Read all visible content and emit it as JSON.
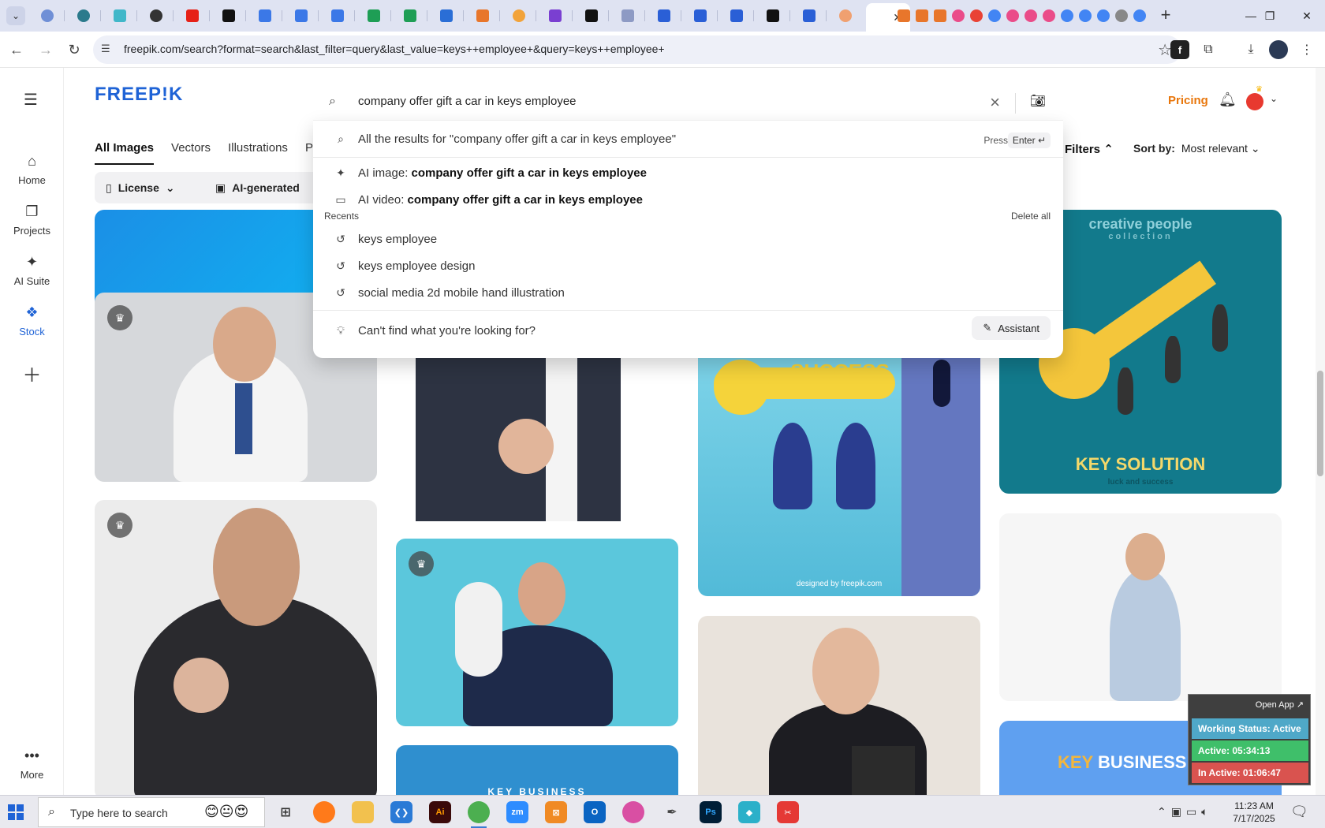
{
  "browser": {
    "active_tab_close": "✕",
    "new_tab": "+",
    "window_controls": [
      "—",
      "❐",
      "✕"
    ],
    "url": "freepik.com/search?format=search&last_filter=query&last_value=keys++employee+&query=keys++employee+"
  },
  "freepik": {
    "logo": "FREEP!K",
    "leftnav": [
      {
        "label": "Home",
        "icon": "home-icon"
      },
      {
        "label": "Projects",
        "icon": "projects-icon"
      },
      {
        "label": "AI Suite",
        "icon": "sparkle-icon"
      },
      {
        "label": "Stock",
        "icon": "stock-icon"
      },
      {
        "label": "",
        "icon": "plus-icon"
      },
      {
        "label": "More",
        "icon": "more-icon"
      }
    ],
    "header": {
      "pricing": "Pricing"
    },
    "tabs": [
      "All Images",
      "Vectors",
      "Illustrations",
      "Ph"
    ],
    "filters": {
      "license": "License",
      "ai_generated": "AI-generated",
      "filters_link": "Filters",
      "sort_label": "Sort by:",
      "sort_value": "Most relevant"
    },
    "search": {
      "query": "company offer gift a car in keys  employee",
      "all_results": "All the results for \"company offer gift a car in keys employee\"",
      "press": "Press",
      "enter": "Enter ↵",
      "ai_image_prefix": "AI image:",
      "ai_image_query": "company offer gift a car in keys employee",
      "ai_video_prefix": "AI video:",
      "ai_video_query": "company offer gift a car in keys employee",
      "recents_label": "Recents",
      "delete_all": "Delete all",
      "recents": [
        "keys employee",
        "keys employee design",
        "social media 2d mobile hand illustration"
      ],
      "cant_find": "Can't find what you're looking for?",
      "assistant": "Assistant"
    },
    "cards": {
      "credit": "designed by freepik.com",
      "success": "SUCCESS",
      "creative": "creative people",
      "collection": "collection",
      "key_solution": "KEY SOLUTION",
      "key_solution_sub": "luck and success",
      "key_business": "KEY BUSINESS",
      "key_business_concept_1": "KEY",
      "key_business_concept_2": "BUSINESS CONCEPT"
    }
  },
  "tracker": {
    "open_app": "Open App ↗",
    "status": "Working Status: Active",
    "active": "Active: 05:34:13",
    "inactive": "In Active: 01:06:47"
  },
  "taskbar": {
    "search_placeholder": "Type here to search",
    "time": "11:23 AM",
    "date": "7/17/2025"
  },
  "colors": {
    "freepik_blue": "#1f63d6",
    "pricing_orange": "#e8760b",
    "tracker_status": "#4fa8c8",
    "tracker_active": "#3fbf6a",
    "tracker_inactive": "#d9534f"
  }
}
